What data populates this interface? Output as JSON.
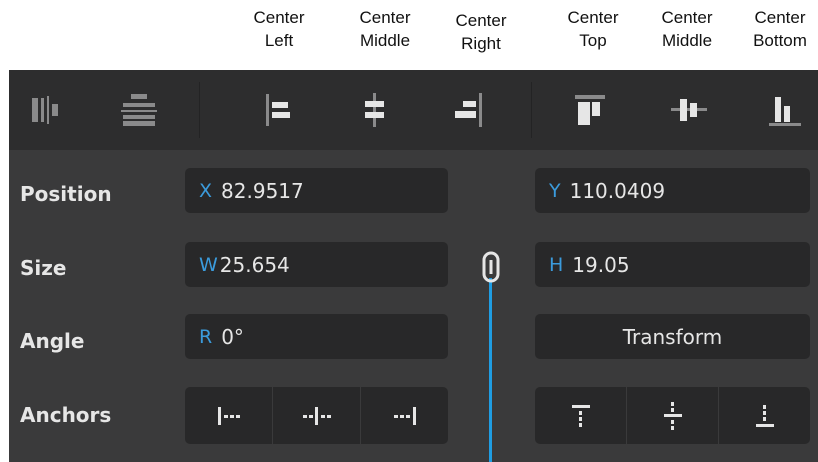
{
  "captions": [
    {
      "line1": "Center",
      "line2": "Left"
    },
    {
      "line1": "Center",
      "line2": "Middle"
    },
    {
      "line1": "Center",
      "line2": "Right"
    },
    {
      "line1": "Center",
      "line2": "Top"
    },
    {
      "line1": "Center",
      "line2": "Middle"
    },
    {
      "line1": "Center",
      "line2": "Bottom"
    }
  ],
  "toolbar": {
    "icons": [
      "distribute-horizontal-icon",
      "distribute-vertical-icon",
      "align-center-left-icon",
      "align-center-middle-icon",
      "align-center-right-icon",
      "align-center-top-icon",
      "align-center-vertical-middle-icon",
      "align-center-bottom-icon"
    ]
  },
  "rows": {
    "position": {
      "label": "Position",
      "x_axis": "X",
      "x_value": "82.9517",
      "y_axis": "Y",
      "y_value": "110.0409"
    },
    "size": {
      "label": "Size",
      "w_axis": "W",
      "w_value": "25.654",
      "h_axis": "H",
      "h_value": "19.05"
    },
    "angle": {
      "label": "Angle",
      "r_axis": "R",
      "r_value": "0°",
      "transform_label": "Transform"
    },
    "anchors": {
      "label": "Anchors",
      "horizontal_icons": [
        "anchor-left-icon",
        "anchor-center-icon",
        "anchor-right-icon"
      ],
      "vertical_icons": [
        "anchor-top-icon",
        "anchor-middle-icon",
        "anchor-bottom-icon"
      ]
    }
  },
  "link_icon": "chain-link-icon",
  "colors": {
    "accent": "#3b9bdc",
    "link_line": "#1f9de3",
    "panel": "#3a3a3b",
    "toolbar": "#2d2d2e",
    "field": "#282829"
  }
}
